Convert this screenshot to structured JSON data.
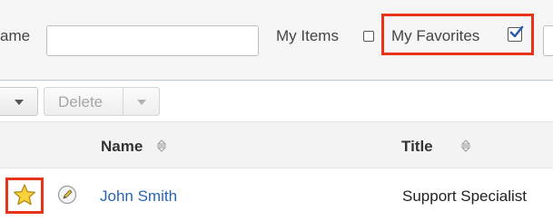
{
  "filters": {
    "name_label": "ame",
    "name_value": "",
    "my_items_label": "My Items",
    "my_items_checked": false,
    "my_favorites_label": "My Favorites",
    "my_favorites_checked": true
  },
  "actions": {
    "delete_label": "Delete"
  },
  "table": {
    "columns": [
      {
        "label": "Name",
        "sortable": true
      },
      {
        "label": "Title",
        "sortable": true
      }
    ],
    "rows": [
      {
        "favorite": true,
        "name": "John Smith",
        "title": "Support Specialist"
      }
    ]
  },
  "icons": {
    "favorite": "star-icon",
    "edit": "pencil-icon",
    "sort": "sort-arrows-icon",
    "dropdown": "chevron-down-icon"
  },
  "colors": {
    "highlight": "#e8331b",
    "link": "#2764b0",
    "star_fill": "#f7d23c"
  }
}
